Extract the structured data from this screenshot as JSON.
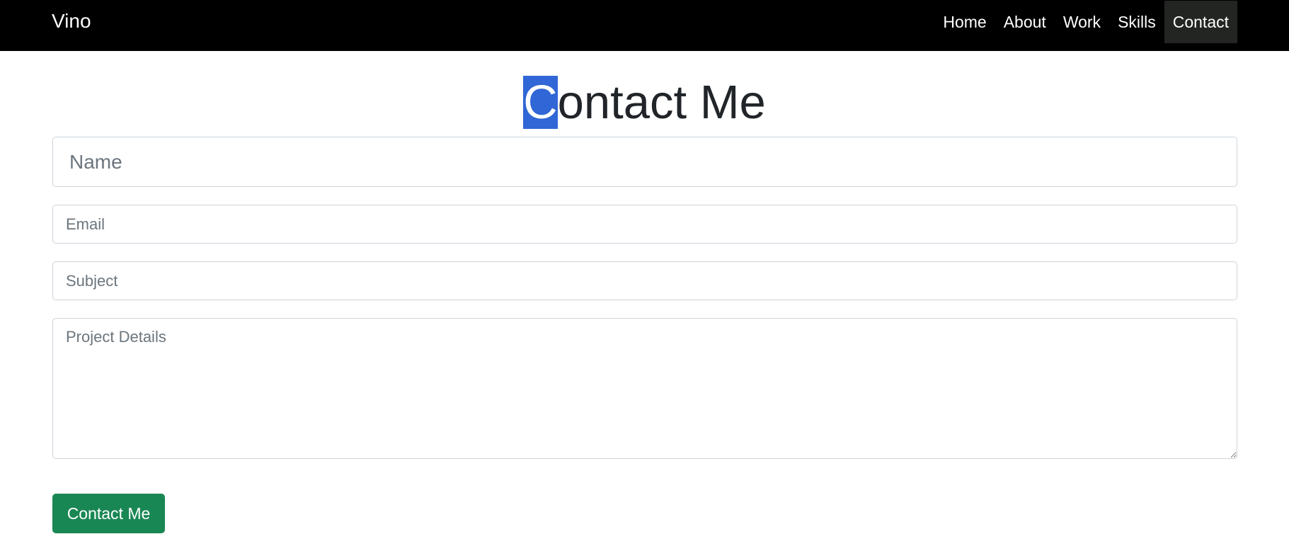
{
  "navbar": {
    "brand": "Vino",
    "items": [
      {
        "label": "Home"
      },
      {
        "label": "About"
      },
      {
        "label": "Work"
      },
      {
        "label": "Skills"
      },
      {
        "label": "Contact",
        "active": true
      }
    ]
  },
  "main": {
    "title_first": "C",
    "title_rest": "ontact Me",
    "highlight_color": "#3166d6",
    "form": {
      "name_placeholder": "Name",
      "email_placeholder": "Email",
      "subject_placeholder": "Subject",
      "details_placeholder": "Project Details",
      "submit_label": "Contact Me",
      "submit_color": "#198754"
    }
  }
}
